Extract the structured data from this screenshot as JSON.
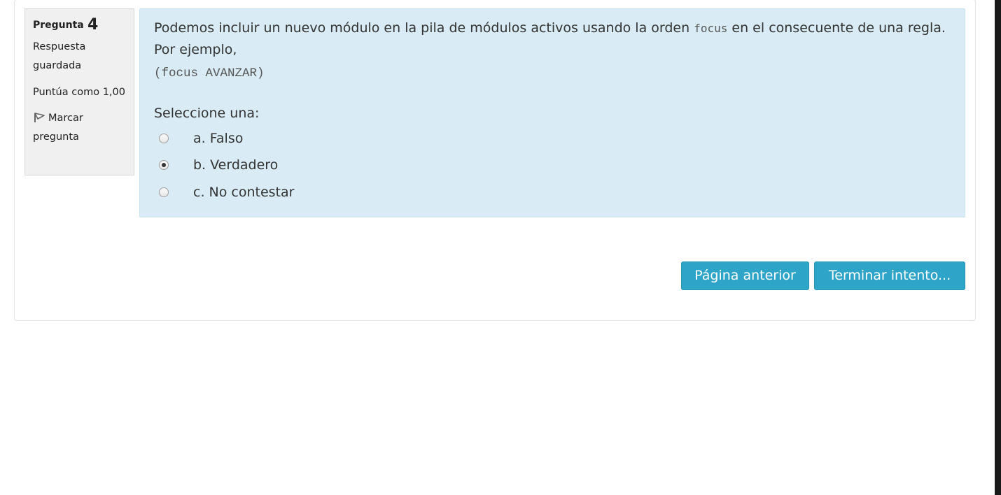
{
  "question_info": {
    "label": "Pregunta",
    "number": "4",
    "state": "Respuesta guardada",
    "grade": "Puntúa como 1,00",
    "flag_label": "Marcar pregunta",
    "flag_icon": "flag-icon"
  },
  "question": {
    "text_before": "Podemos incluir un nuevo módulo en la pila de módulos activos usando la orden ",
    "inline_code": "focus",
    "text_after": " en el consecuente de una regla. Por ejemplo,",
    "code_example": "(focus AVANZAR)",
    "prompt": "Seleccione una:",
    "options": [
      {
        "label": "a. Falso",
        "selected": false
      },
      {
        "label": "b. Verdadero",
        "selected": true
      },
      {
        "label": "c. No contestar",
        "selected": false
      }
    ]
  },
  "nav": {
    "prev_label": "Página anterior",
    "finish_label": "Terminar intento..."
  },
  "colors": {
    "question_bg": "#d9ecf5",
    "info_bg": "#f0f0f0",
    "button_bg": "#2fa4c9"
  }
}
